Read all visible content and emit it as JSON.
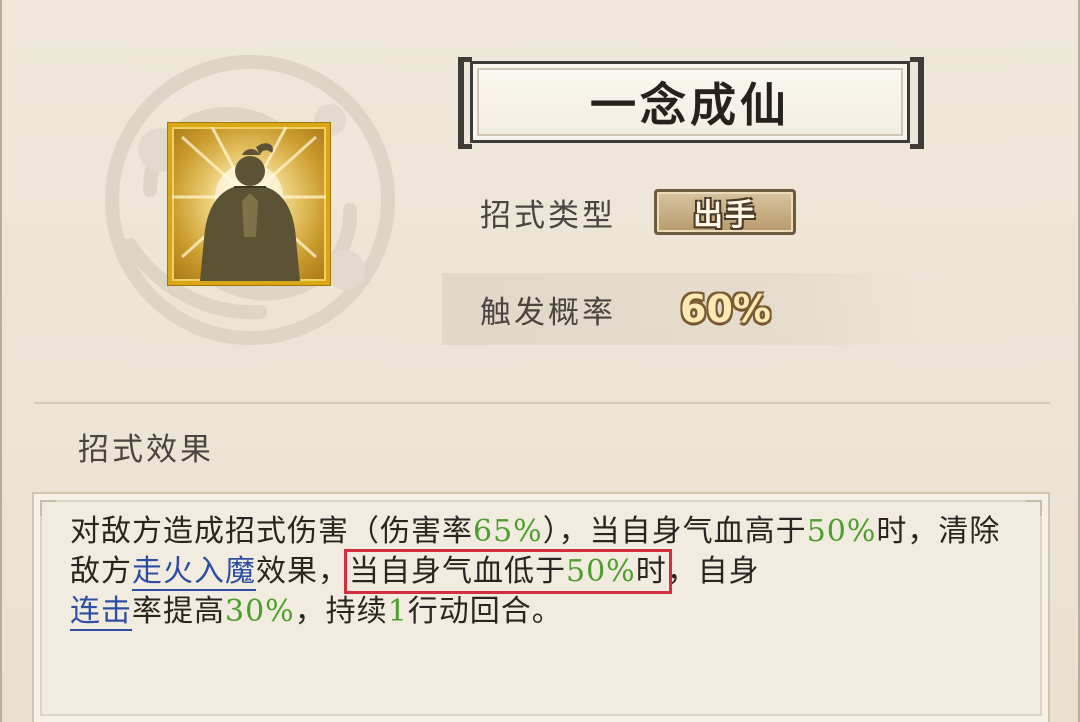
{
  "skill": {
    "name": "一念成仙",
    "icon": "meditating-figure-icon"
  },
  "info": {
    "type_label": "招式类型",
    "type_value": "出手",
    "probability_label": "触发概率",
    "probability_value": "60%"
  },
  "effect": {
    "section_title": "招式效果",
    "parts": {
      "p1": "对敌方造成招式伤害（伤害率",
      "p2": "65%",
      "p3": "），当自身气血高于",
      "p4": "50%",
      "p5": "时，清除敌方",
      "link1": "走火入魔",
      "p6": "效果，",
      "h1": "当自身气血低于",
      "h2": "50%",
      "h3": "时",
      "p7": "，自身",
      "link2": "连击",
      "p8": "率提高",
      "p9": "30%",
      "p10": "，持续",
      "p11": "1",
      "p12": "行动回合。"
    }
  },
  "colors": {
    "highlight_value": "#4c9f2c",
    "link": "#2d4fa2",
    "annotation_box": "#d22f3f",
    "icon_border": "#d9a519"
  }
}
